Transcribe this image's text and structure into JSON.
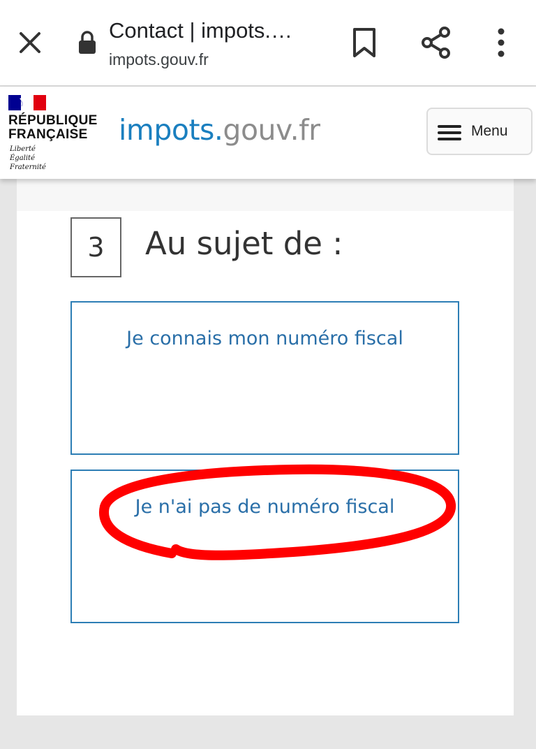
{
  "browser": {
    "title": "Contact | impots.…",
    "url": "impots.gouv.fr"
  },
  "site_header": {
    "republique_line1": "RÉPUBLIQUE",
    "republique_line2": "FRANÇAISE",
    "motto": [
      "Liberté",
      "Égalité",
      "Fraternité"
    ],
    "brand_part1": "impots.",
    "brand_part2": "gouv.fr",
    "menu_label": "Menu"
  },
  "step": {
    "number": "3",
    "heading": "Au sujet de :"
  },
  "options": [
    {
      "label": "Je connais mon numéro fiscal"
    },
    {
      "label": "Je n'ai pas de numéro fiscal"
    }
  ],
  "colors": {
    "brand_blue": "#1a7fbf",
    "brand_gray": "#8c8c8c",
    "option_border": "#2d7eb5",
    "annotation_red": "#ff0000"
  }
}
